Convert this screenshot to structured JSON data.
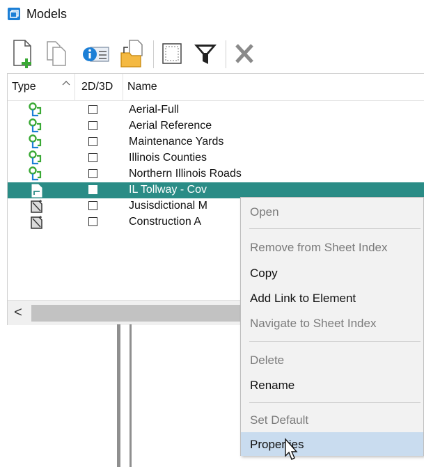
{
  "window": {
    "title": "Models",
    "icon": "models-window-icon"
  },
  "toolbar": {
    "buttons": [
      {
        "name": "create-model-button",
        "icon": "new-document-plus-icon"
      },
      {
        "name": "copy-model-button",
        "icon": "copy-document-icon"
      },
      {
        "name": "model-properties-button",
        "icon": "info-properties-icon"
      },
      {
        "name": "import-model-button",
        "icon": "folder-import-icon"
      },
      {
        "name": "select-all-button",
        "icon": "select-box-icon"
      },
      {
        "name": "filter-button",
        "icon": "funnel-filter-icon"
      },
      {
        "name": "delete-model-button",
        "icon": "x-delete-icon"
      }
    ]
  },
  "grid": {
    "columns": [
      {
        "label": "Type",
        "sorted": "ascending"
      },
      {
        "label": "2D/3D"
      },
      {
        "label": "Name"
      }
    ],
    "rows": [
      {
        "type_icon": "reference-link-icon",
        "checked": false,
        "name": "Aerial-Full"
      },
      {
        "type_icon": "reference-link-icon",
        "checked": false,
        "name": "Aerial Reference"
      },
      {
        "type_icon": "reference-link-icon",
        "checked": false,
        "name": "Maintenance Yards"
      },
      {
        "type_icon": "reference-link-icon",
        "checked": false,
        "name": "Illinois Counties"
      },
      {
        "type_icon": "reference-link-icon",
        "checked": false,
        "name": "Northern Illinois Roads"
      },
      {
        "type_icon": "sheet-model-icon",
        "checked": false,
        "name": "IL Tollway - Cov",
        "selected": true
      },
      {
        "type_icon": "drawing-model-icon",
        "checked": false,
        "name": "Jusisdictional M"
      },
      {
        "type_icon": "drawing-model-icon",
        "checked": false,
        "name": "Construction A"
      }
    ],
    "scroll_left": "<"
  },
  "context_menu": {
    "items": [
      {
        "label": "Open",
        "enabled": false
      },
      {
        "separator": true
      },
      {
        "label": "Remove from Sheet Index",
        "enabled": false
      },
      {
        "label": "Copy",
        "enabled": true
      },
      {
        "label": "Add Link to Element",
        "enabled": true
      },
      {
        "label": "Navigate to Sheet Index",
        "enabled": false
      },
      {
        "separator": true
      },
      {
        "label": "Delete",
        "enabled": false
      },
      {
        "label": "Rename",
        "enabled": true
      },
      {
        "separator": true
      },
      {
        "label": "Set Default",
        "enabled": false
      },
      {
        "label": "Properties",
        "enabled": true,
        "highlighted": true
      }
    ]
  },
  "colors": {
    "selection": "#2a8c86",
    "menu_highlight": "#c9dcef",
    "icon_green": "#3aa935",
    "icon_blue": "#1c7fd6"
  }
}
